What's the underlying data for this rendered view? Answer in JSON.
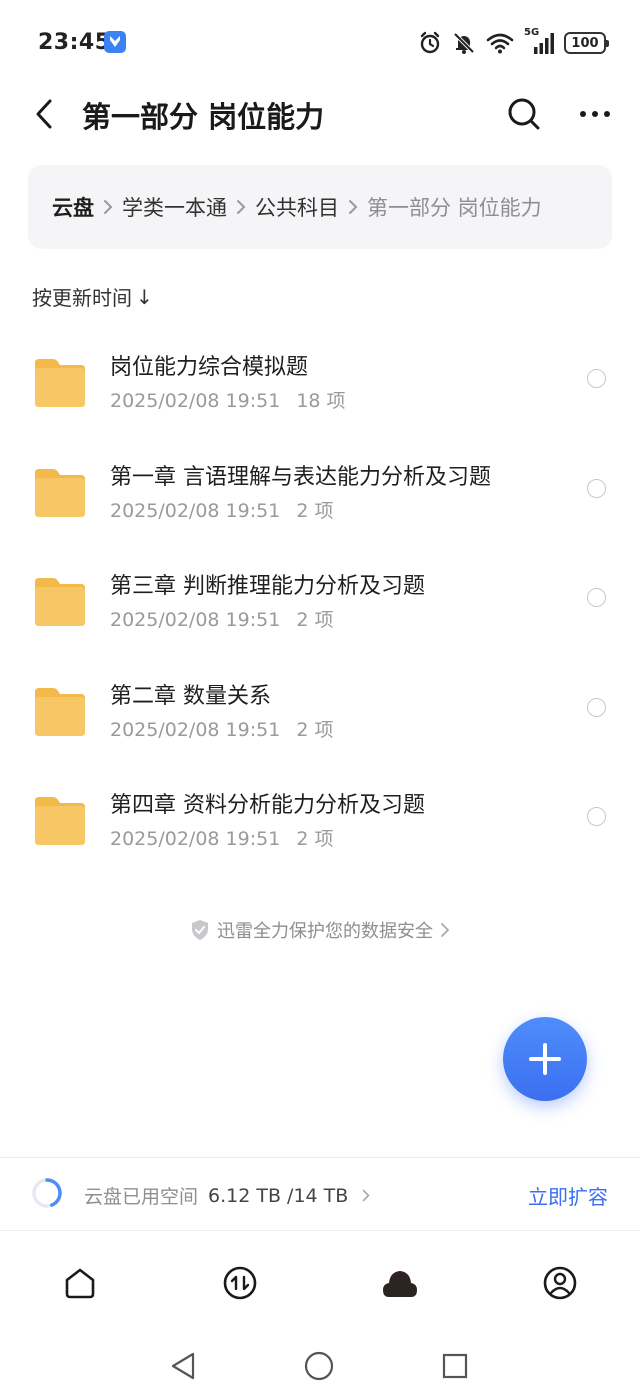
{
  "status_bar": {
    "time": "23:45",
    "network": "5G",
    "battery": "100",
    "icons": [
      "alarm-icon",
      "mute-icon",
      "wifi-icon",
      "signal-icon",
      "battery-icon"
    ]
  },
  "header": {
    "title": "第一部分 岗位能力",
    "back_icon": "back-arrow-icon",
    "search_icon": "search-icon",
    "more_icon": "more-icon"
  },
  "breadcrumb": {
    "root": "云盘",
    "items": [
      "学类一本通",
      "公共科目"
    ],
    "current": "第一部分 岗位能力"
  },
  "sort": {
    "label": "按更新时间",
    "arrow": "↓"
  },
  "files": [
    {
      "name": "岗位能力综合模拟题",
      "date": "2025/02/08 19:51",
      "count": "18 项"
    },
    {
      "name": "第一章  言语理解与表达能力分析及习题",
      "date": "2025/02/08 19:51",
      "count": "2 项"
    },
    {
      "name": "第三章 判断推理能力分析及习题",
      "date": "2025/02/08 19:51",
      "count": "2 项"
    },
    {
      "name": "第二章 数量关系",
      "date": "2025/02/08 19:51",
      "count": "2 项"
    },
    {
      "name": "第四章 资料分析能力分析及习题",
      "date": "2025/02/08 19:51",
      "count": "2 项"
    }
  ],
  "security_note": "迅雷全力保护您的数据安全",
  "storage": {
    "label": "云盘已用空间",
    "value": "6.12 TB /14 TB",
    "used_fraction": 0.437,
    "expand_label": "立即扩容"
  },
  "tabs": [
    "home-tab",
    "transfer-tab",
    "cloud-tab",
    "profile-tab"
  ],
  "colors": {
    "accent": "#3b6ff0",
    "folder": "#f7c765",
    "breadcrumb_bg": "#f5f5f7"
  }
}
